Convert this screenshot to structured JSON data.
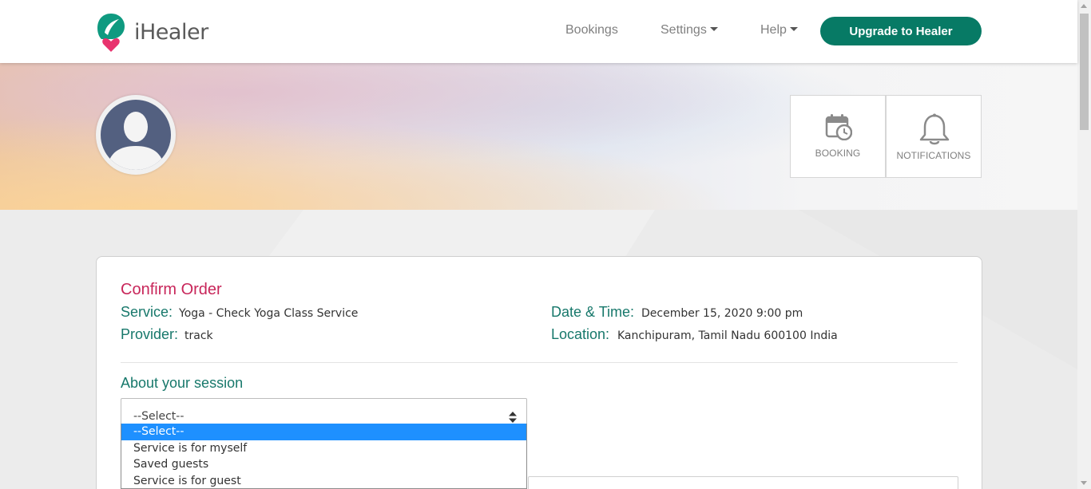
{
  "brand": {
    "name": "iHealer",
    "accent": "#077a65",
    "title_color": "#c8265a"
  },
  "nav": {
    "bookings": "Bookings",
    "settings": "Settings",
    "help": "Help",
    "upgrade": "Upgrade to Healer"
  },
  "profile": {
    "avatar_icon": "user-silhouette-icon",
    "tiles": [
      {
        "label": "BOOKING",
        "icon": "calendar-clock-icon"
      },
      {
        "label": "NOTIFICATIONS",
        "icon": "bell-icon"
      }
    ]
  },
  "order": {
    "title": "Confirm Order",
    "service_label": "Service:",
    "service_value": "Yoga - Check Yoga Class Service",
    "provider_label": "Provider:",
    "provider_value": "track",
    "datetime_label": "Date & Time:",
    "datetime_value": "December 15, 2020 9:00 pm",
    "location_label": "Location:",
    "location_value": "Kanchipuram, Tamil Nadu 600100 India"
  },
  "session": {
    "title": "About your session",
    "selected": "--Select--",
    "options": [
      "--Select--",
      "Service is for myself",
      "Saved guests",
      "Service is for guest"
    ]
  }
}
